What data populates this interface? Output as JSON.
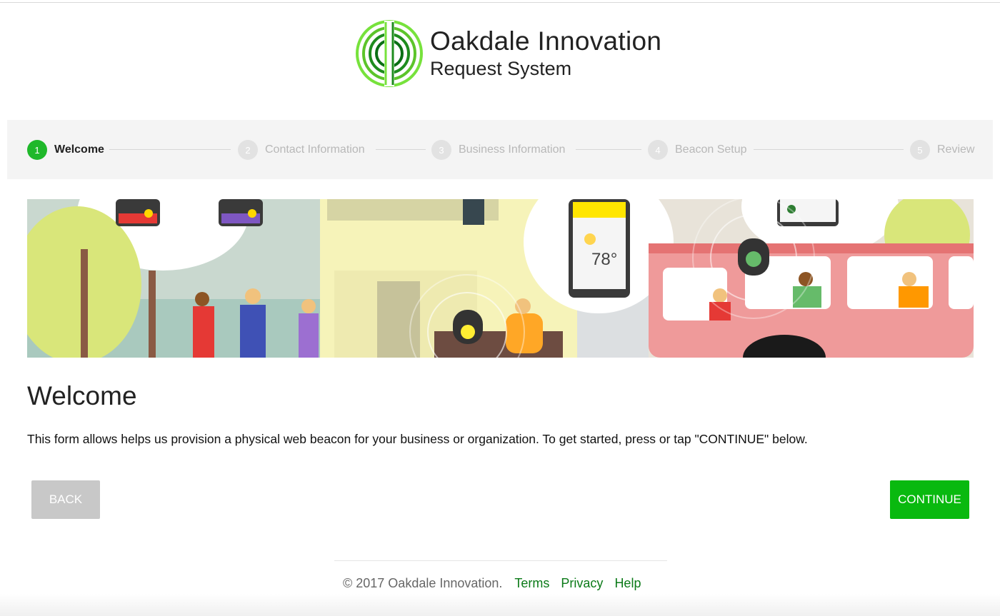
{
  "brand": {
    "line1": "Oakdale Innovation",
    "line2": "Request System",
    "logo_icon": "concentric-circles-logo-icon",
    "accent_colors": [
      "#6fe03b",
      "#1e8c1e",
      "#0b6f15"
    ]
  },
  "stepper": {
    "steps": [
      {
        "number": "1",
        "label": "Welcome",
        "active": true
      },
      {
        "number": "2",
        "label": "Contact Information",
        "active": false
      },
      {
        "number": "3",
        "label": "Business Information",
        "active": false
      },
      {
        "number": "4",
        "label": "Beacon Setup",
        "active": false
      },
      {
        "number": "5",
        "label": "Review",
        "active": false
      }
    ],
    "active_color": "#1fb82a"
  },
  "hero": {
    "temperature": "78°"
  },
  "welcome": {
    "title": "Welcome",
    "text": "This form allows helps us provision a physical web beacon for your business or organization. To get started, press or tap \"CONTINUE\" below."
  },
  "actions": {
    "back_label": "BACK",
    "continue_label": "CONTINUE",
    "continue_color": "#09b90f"
  },
  "footer": {
    "copyright": "© 2017 Oakdale Innovation.",
    "links": [
      "Terms",
      "Privacy",
      "Help"
    ]
  }
}
